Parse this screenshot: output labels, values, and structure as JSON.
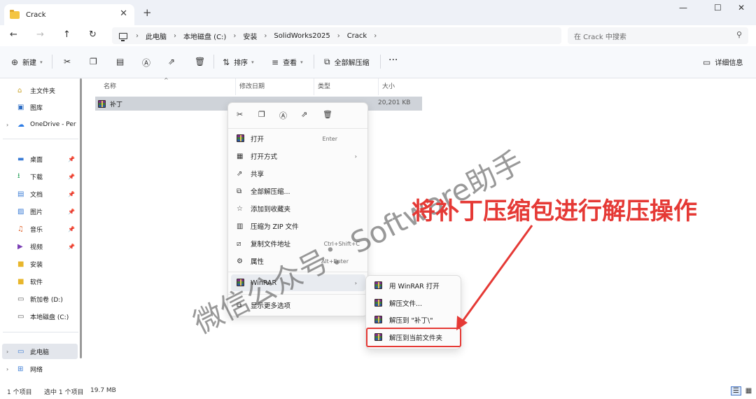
{
  "window": {
    "tab_title": "Crack",
    "tab_close": "✕",
    "new_tab": "+",
    "minimize": "—",
    "maximize": "☐",
    "close": "✕"
  },
  "nav": {
    "back": "←",
    "forward": "→",
    "up": "↑",
    "refresh": "↻"
  },
  "breadcrumbs": [
    "此电脑",
    "本地磁盘 (C:)",
    "安装",
    "SolidWorks2025",
    "Crack"
  ],
  "crumb_sep": "›",
  "search": {
    "placeholder": "在 Crack 中搜索",
    "icon": "search-icon"
  },
  "toolbar": {
    "new_label": "新建",
    "sort_label": "排序",
    "view_label": "查看",
    "extract_all_label": "全部解压缩",
    "more": "···",
    "details_label": "详细信息"
  },
  "sidebar": {
    "items": [
      {
        "label": "主文件夹",
        "icon": "home-icon"
      },
      {
        "label": "图库",
        "icon": "gallery-icon"
      },
      {
        "label": "OneDrive - Per",
        "icon": "cloud-icon"
      },
      {
        "label": "桌面",
        "icon": "desktop-icon"
      },
      {
        "label": "下载",
        "icon": "download-icon"
      },
      {
        "label": "文档",
        "icon": "document-icon"
      },
      {
        "label": "图片",
        "icon": "picture-icon"
      },
      {
        "label": "音乐",
        "icon": "music-icon"
      },
      {
        "label": "视频",
        "icon": "video-icon"
      },
      {
        "label": "安装",
        "icon": "folder-icon"
      },
      {
        "label": "软件",
        "icon": "folder-icon"
      },
      {
        "label": "新加卷 (D:)",
        "icon": "drive-icon"
      },
      {
        "label": "本地磁盘 (C:)",
        "icon": "drive-icon"
      },
      {
        "label": "此电脑",
        "icon": "computer-icon"
      },
      {
        "label": "网络",
        "icon": "network-icon"
      }
    ]
  },
  "list": {
    "columns": [
      "名称",
      "修改日期",
      "类型",
      "大小"
    ],
    "rows": [
      {
        "name": "补丁",
        "size": "20,201 KB"
      }
    ]
  },
  "context_menu": {
    "items": [
      {
        "label": "打开",
        "shortcut": "Enter"
      },
      {
        "label": "打开方式"
      },
      {
        "label": "共享"
      },
      {
        "label": "全部解压缩..."
      },
      {
        "label": "添加到收藏夹"
      },
      {
        "label": "压缩为 ZIP 文件"
      },
      {
        "label": "复制文件地址",
        "shortcut": "Ctrl+Shift+C"
      },
      {
        "label": "属性",
        "shortcut": "Alt+Enter"
      },
      {
        "label": "WinRAR"
      },
      {
        "label": "显示更多选项"
      }
    ],
    "submenu_arrow": "›"
  },
  "submenu": {
    "items": [
      {
        "label": "用 WinRAR 打开"
      },
      {
        "label": "解压文件..."
      },
      {
        "label": "解压到 \"补丁\\\""
      },
      {
        "label": "解压到当前文件夹"
      }
    ]
  },
  "status": {
    "count": "1 个项目",
    "selected": "选中 1 个项目",
    "size": "19.7 MB"
  },
  "overlay": {
    "watermark": "微信公众号：Software助手",
    "annotation": "将补丁压缩包进行解压操作",
    "annotation_color": "#e53935"
  }
}
